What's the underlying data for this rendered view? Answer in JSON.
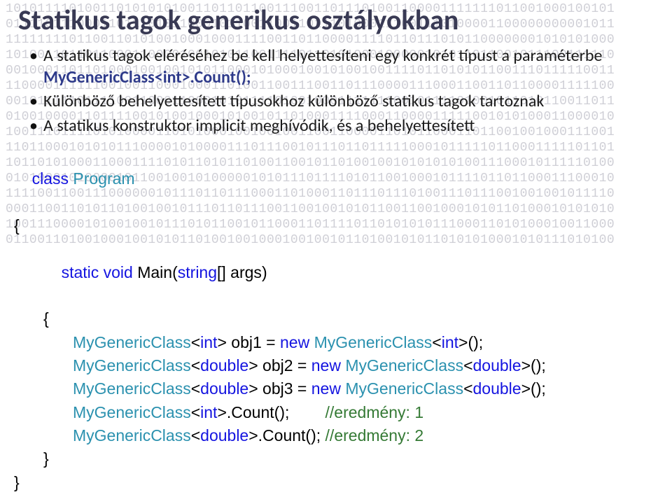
{
  "background_rows": [
    "10101111010011010101010011011011001110011011101001100001111111011001000100101",
    "01111011100011011101011000101100110011011101000111001110100001100000000001011",
    "11111111011001101010010001000111100110110000111101101110101100000001010101000",
    "10100110110110001100001001010110011110110101000100000101011011001011100111110",
    "00100011011010001001001010110001010001001010010011110110101011001110111110011",
    "11000011111100100110001000110100110011100110111000011100011001101100001111100",
    "00101111101111001100011000101011110100100011111110010111101001011010110011011",
    "01001000011011110010100100010100101101000111100011000011111001010100011000010",
    "10011101111010100001101010001001001001100110000110101100011011001001000111001",
    "11011000101010111000010100001110111001011101101111100010111110110001111101101",
    "10110101000110001111010110101101001100101101001001010101010011100010111110100",
    "01010001010000101100100101000001010111011110101100100010111101101100011100010",
    "11110011001110000001011101101110001101000110111011101001110111001001001011110",
    "00011001101011010010010111011011100110010010101100110010001010110100010101010",
    "10011100001010010010111010110010110001101111011010101011100011010100010011000",
    "01100110100100010010101101001001000100100101101001010110101010001010111010100"
  ],
  "title": "Statikus tagok generikus osztályokban",
  "bullets": {
    "b1_part1": "A statikus tagok eléréséhez be kell helyettesíteni egy konkrét típust a paraméterbe",
    "b1_code": "MyGenericClass<int>.Count();",
    "b2": "Különböző behelyettesített típusokhoz különböző statikus tagok tartoznak",
    "b3": "A statikus konstruktor implicit meghívódik, és a behelyettesített"
  },
  "code": {
    "kw_class": "class",
    "cls_program": "Program",
    "brace_open": "{",
    "brace_close": "}",
    "kw_static": "static",
    "kw_void": "void",
    "kw_new": "new",
    "method_main": "Main",
    "type_stringarr": "string",
    "param_args": "[] args",
    "lparen": "(",
    "rparen": ")",
    "mgc": "MyGenericClass",
    "t_int": "int",
    "t_double": "double",
    "lt": "<",
    "gt": ">",
    "v_obj1": " obj1 = ",
    "v_obj2": " obj2 = ",
    "v_obj3": " obj3 = ",
    "call_end": "();",
    "count_call": ".Count();",
    "space_gap1": "        ",
    "space_gap2": " ",
    "cmt1": "//eredmény: 1",
    "cmt2": "//eredmény: 2"
  }
}
